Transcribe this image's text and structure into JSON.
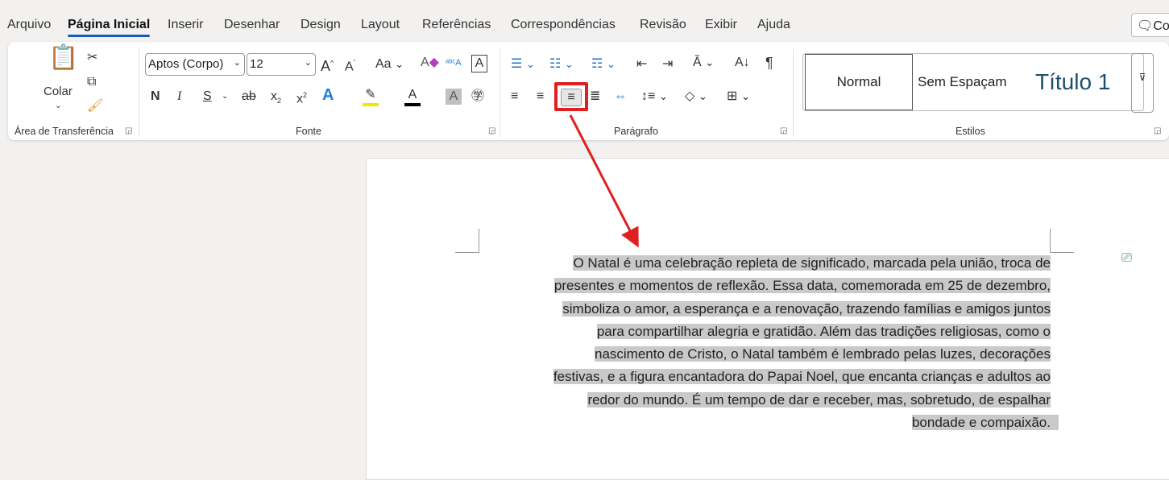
{
  "menu": {
    "tabs": [
      "Arquivo",
      "Página Inicial",
      "Inserir",
      "Desenhar",
      "Design",
      "Layout",
      "Referências",
      "Correspondências",
      "Revisão",
      "Exibir",
      "Ajuda"
    ],
    "active": "Página Inicial",
    "comments_label": "Co"
  },
  "ribbon": {
    "clipboard": {
      "paste_label": "Colar",
      "group_label": "Área de Transferência"
    },
    "font": {
      "font_name": "Aptos (Corpo)",
      "font_size": "12",
      "group_label": "Fonte",
      "bold": "N",
      "italic": "I",
      "underline": "S",
      "strike": "ab",
      "grow": "A",
      "shrink": "A",
      "case": "Aa",
      "highlight_color": "#f5e600",
      "font_color": "#000000"
    },
    "paragraph": {
      "group_label": "Parágrafo",
      "selected_alignment": "right"
    },
    "styles": {
      "items": [
        "Normal",
        "Sem Espaçam",
        "Título 1"
      ],
      "group_label": "Estilos",
      "heading_color": "#1f4e6b"
    }
  },
  "document": {
    "lines": [
      "O Natal é uma celebração repleta de significado, marcada pela união, troca de",
      "presentes e momentos de reflexão. Essa data, comemorada em 25 de dezembro,",
      "simboliza o amor, a esperança e a renovação, trazendo famílias e amigos juntos",
      "para compartilhar alegria e gratidão. Além das tradições religiosas, como o",
      "nascimento de Cristo, o Natal também é lembrado pelas luzes, decorações",
      "festivas, e a figura encantadora do Papai Noel, que encanta crianças e adultos ao",
      "redor do mundo. É um tempo de dar e receber, mas, sobretudo, de espalhar",
      "bondade e compaixão."
    ]
  },
  "annotation_color": "#e02020"
}
